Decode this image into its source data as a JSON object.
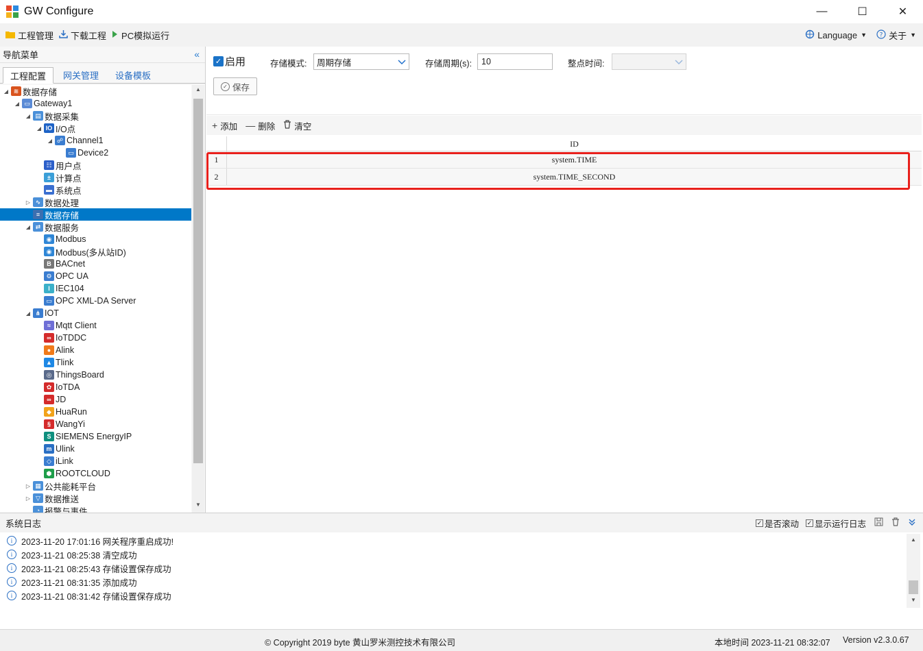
{
  "window": {
    "title": "GW Configure",
    "min_glyph": "—",
    "max_glyph": "☐",
    "close_glyph": "✕"
  },
  "menu": {
    "project_mgmt": "工程管理",
    "download_project": "下载工程",
    "pc_sim": "PC模拟运行",
    "language": "Language",
    "about": "关于"
  },
  "nav": {
    "title": "导航菜单",
    "tabs": [
      "工程配置",
      "网关管理",
      "设备模板"
    ],
    "tree": [
      {
        "label": "数据存储",
        "level": 0,
        "toggle": "◢",
        "icon": "layers-icon",
        "color": "#d9531e"
      },
      {
        "label": "Gateway1",
        "level": 1,
        "toggle": "◢",
        "icon": "gateway-icon",
        "color": "#5b8bd6"
      },
      {
        "label": "数据采集",
        "level": 2,
        "toggle": "◢",
        "icon": "chart-icon",
        "color": "#4a90d9"
      },
      {
        "label": "I/O点",
        "level": 3,
        "toggle": "◢",
        "icon": "io-icon",
        "color": "#1e63c6"
      },
      {
        "label": "Channel1",
        "level": 4,
        "toggle": "◢",
        "icon": "network-icon",
        "color": "#3a7dd0"
      },
      {
        "label": "Device2",
        "level": 5,
        "toggle": "",
        "icon": "device-icon",
        "color": "#3a7dd0"
      },
      {
        "label": "用户点",
        "level": 3,
        "toggle": "",
        "icon": "user-point-icon",
        "color": "#2c5fc9"
      },
      {
        "label": "计算点",
        "level": 3,
        "toggle": "",
        "icon": "calc-icon",
        "color": "#3b9fd8"
      },
      {
        "label": "系统点",
        "level": 3,
        "toggle": "",
        "icon": "system-icon",
        "color": "#3a6fd0"
      },
      {
        "label": "数据处理",
        "level": 2,
        "toggle": "▷",
        "icon": "wave-icon",
        "color": "#4a90d9"
      },
      {
        "label": "数据存储",
        "level": 2,
        "toggle": "",
        "icon": "database-icon",
        "color": "#3b6fb0",
        "selected": true
      },
      {
        "label": "数据服务",
        "level": 2,
        "toggle": "◢",
        "icon": "service-icon",
        "color": "#4a90d9"
      },
      {
        "label": "Modbus",
        "level": 3,
        "toggle": "",
        "icon": "modbus-icon",
        "color": "#2f86d6"
      },
      {
        "label": "Modbus(多从站ID)",
        "level": 3,
        "toggle": "",
        "icon": "modbus-icon",
        "color": "#2f86d6"
      },
      {
        "label": "BACnet",
        "level": 3,
        "toggle": "",
        "icon": "bacnet-icon",
        "color": "#777777"
      },
      {
        "label": "OPC UA",
        "level": 3,
        "toggle": "",
        "icon": "opcua-icon",
        "color": "#3a7dd0"
      },
      {
        "label": "IEC104",
        "level": 3,
        "toggle": "",
        "icon": "iec-icon",
        "color": "#3bb0c9"
      },
      {
        "label": "OPC XML-DA Server",
        "level": 3,
        "toggle": "",
        "icon": "opc-xml-icon",
        "color": "#3a7dd0"
      },
      {
        "label": "IOT",
        "level": 2,
        "toggle": "◢",
        "icon": "iot-icon",
        "color": "#3a7dd0"
      },
      {
        "label": "Mqtt Client",
        "level": 3,
        "toggle": "",
        "icon": "mqtt-icon",
        "color": "#6f6fd6"
      },
      {
        "label": "IoTDDC",
        "level": 3,
        "toggle": "",
        "icon": "iotddc-icon",
        "color": "#d42b2b"
      },
      {
        "label": "Alink",
        "level": 3,
        "toggle": "",
        "icon": "alink-icon",
        "color": "#f07a1a"
      },
      {
        "label": "Tlink",
        "level": 3,
        "toggle": "",
        "icon": "tlink-icon",
        "color": "#1e88e5"
      },
      {
        "label": "ThingsBoard",
        "level": 3,
        "toggle": "",
        "icon": "thingsboard-icon",
        "color": "#5a6a8a"
      },
      {
        "label": "IoTDA",
        "level": 3,
        "toggle": "",
        "icon": "huawei-icon",
        "color": "#d42b2b"
      },
      {
        "label": "JD",
        "level": 3,
        "toggle": "",
        "icon": "jd-icon",
        "color": "#d42b2b"
      },
      {
        "label": "HuaRun",
        "level": 3,
        "toggle": "",
        "icon": "huarun-icon",
        "color": "#f2a31b"
      },
      {
        "label": "WangYi",
        "level": 3,
        "toggle": "",
        "icon": "wangyi-icon",
        "color": "#d42b2b"
      },
      {
        "label": "SIEMENS EnergyIP",
        "level": 3,
        "toggle": "",
        "icon": "siemens-icon",
        "color": "#0f8f7e"
      },
      {
        "label": "Ulink",
        "level": 3,
        "toggle": "",
        "icon": "ulink-icon",
        "color": "#2a6fc4"
      },
      {
        "label": "iLink",
        "level": 3,
        "toggle": "",
        "icon": "ilink-icon",
        "color": "#3a7dd0"
      },
      {
        "label": "ROOTCLOUD",
        "level": 3,
        "toggle": "",
        "icon": "rootcloud-icon",
        "color": "#1e9e4a"
      },
      {
        "label": "公共能耗平台",
        "level": 2,
        "toggle": "▷",
        "icon": "energy-icon",
        "color": "#4a90d9"
      },
      {
        "label": "数据推送",
        "level": 2,
        "toggle": "▷",
        "icon": "push-icon",
        "color": "#4a90d9"
      },
      {
        "label": "报警与事件",
        "level": 2,
        "toggle": "",
        "icon": "alarm-icon",
        "color": "#4a90d9"
      }
    ]
  },
  "settings": {
    "enable_label": "启用",
    "storage_mode_label": "存储模式:",
    "storage_mode_value": "周期存储",
    "storage_period_label": "存储周期(s):",
    "storage_period_value": "10",
    "whole_time_label": "整点时间:",
    "whole_time_value": "",
    "save_label": "保存"
  },
  "toolbar": {
    "add": "添加",
    "delete": "删除",
    "clear": "清空"
  },
  "grid": {
    "column": "ID",
    "rows": [
      {
        "num": "1",
        "id": "system.TIME"
      },
      {
        "num": "2",
        "id": "system.TIME_SECOND"
      }
    ]
  },
  "log": {
    "title": "系统日志",
    "auto_scroll": "是否滚动",
    "show_runtime": "显示运行日志",
    "entries": [
      "2023-11-20 17:01:16 网关程序重启成功!",
      "2023-11-21 08:25:38 清空成功",
      "2023-11-21 08:25:43 存储设置保存成功",
      "2023-11-21 08:31:35 添加成功",
      "2023-11-21 08:31:42 存储设置保存成功"
    ]
  },
  "status": {
    "copyright": "© Copyright 2019 byte 黄山罗米测控技术有限公司",
    "local_time": "本地时间 2023-11-21 08:32:07",
    "version": "Version v2.3.0.67"
  },
  "colors": {
    "accent": "#0078c8",
    "highlight": "#e8201c"
  }
}
